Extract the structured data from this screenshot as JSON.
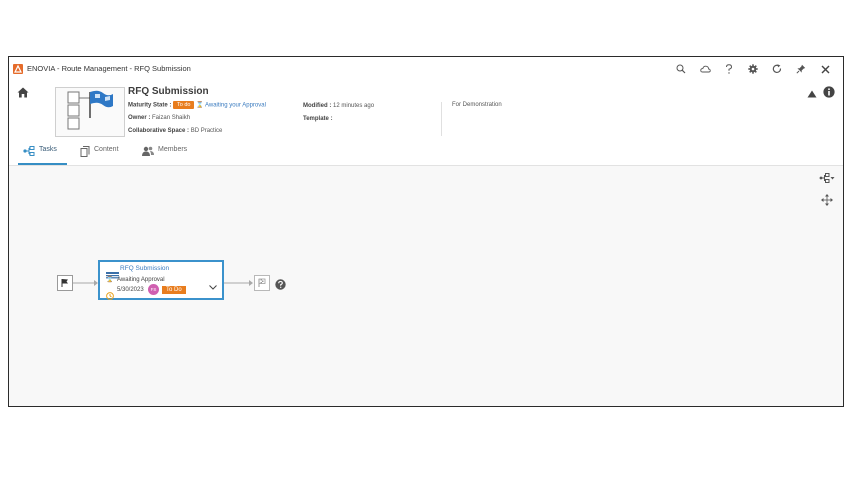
{
  "window": {
    "title": "ENOVIA - Route Management - RFQ Submission",
    "toolbar_icons": [
      "search-icon",
      "cloud-icon",
      "help-icon",
      "settings-icon",
      "refresh-icon",
      "pin-icon",
      "close-icon"
    ]
  },
  "header": {
    "object_title": "RFQ Submission",
    "maturity_label": "Maturity State :",
    "maturity_value": "To do",
    "approval_link": "Awaiting your Approval",
    "owner_label": "Owner :",
    "owner_value": "Faizan Shaikh",
    "collab_label": "Collaborative Space :",
    "collab_value": "BD Practice",
    "modified_label": "Modified :",
    "modified_value": "12 minutes ago",
    "template_label": "Template :",
    "template_value": "",
    "description": "For Demonstration"
  },
  "tabs": [
    {
      "label": "Tasks",
      "icon": "tasks-icon",
      "active": true
    },
    {
      "label": "Content",
      "icon": "content-icon",
      "active": false
    },
    {
      "label": "Members",
      "icon": "members-icon",
      "active": false
    }
  ],
  "task": {
    "title": "RFQ Submission",
    "status": "Awaiting Approval",
    "due_date": "5/30/2023",
    "assignee_initials": "FS",
    "badge": "To Do"
  },
  "colors": {
    "accent_blue": "#3b92cc",
    "todo_orange": "#e87d1e",
    "avatar_pink": "#d05fb0",
    "app_logo": "#e56b2a"
  }
}
